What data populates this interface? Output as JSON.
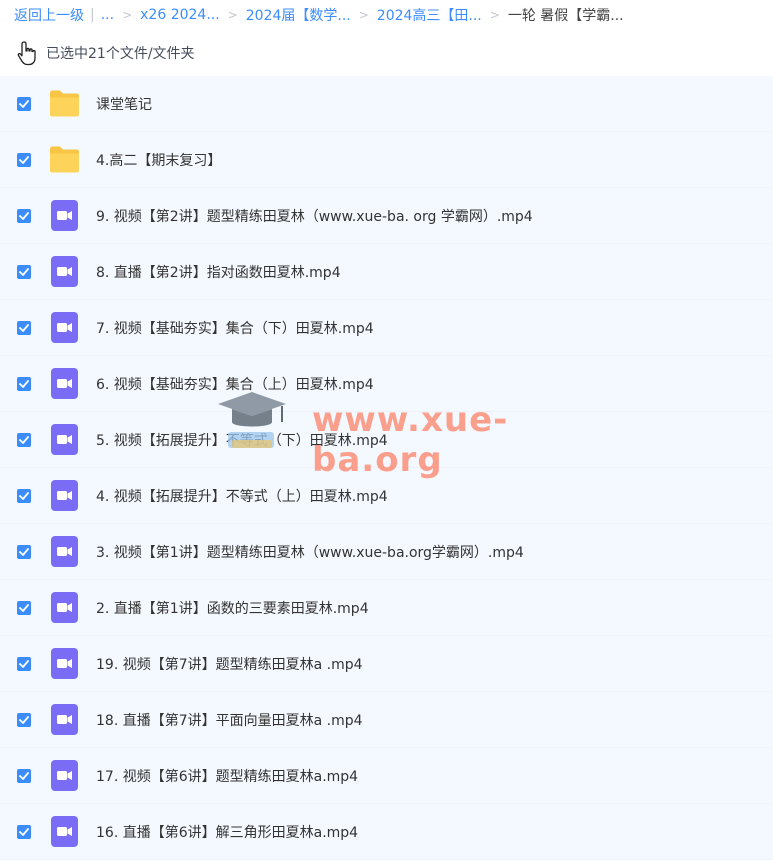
{
  "breadcrumb": {
    "back": "返回上一级",
    "ellipsis": "...",
    "items": [
      "x26 2024...",
      "2024届【数学...",
      "2024高三【田..."
    ],
    "current": "一轮 暑假【学霸..."
  },
  "selection": {
    "text": "已选中21个文件/文件夹"
  },
  "files": [
    {
      "type": "folder",
      "name": "课堂笔记",
      "checked": true
    },
    {
      "type": "folder",
      "name": "4.高二【期末复习】",
      "checked": true
    },
    {
      "type": "video",
      "name": "9. 视频【第2讲】题型精练田夏林（www.xue-ba. org 学霸网）.mp4",
      "checked": true
    },
    {
      "type": "video",
      "name": "8. 直播【第2讲】指对函数田夏林.mp4",
      "checked": true
    },
    {
      "type": "video",
      "name": "7. 视频【基础夯实】集合（下）田夏林.mp4",
      "checked": true
    },
    {
      "type": "video",
      "name": "6. 视频【基础夯实】集合（上）田夏林.mp4",
      "checked": true
    },
    {
      "type": "video",
      "name": "5. 视频【拓展提升】不等式（下）田夏林.mp4",
      "checked": true
    },
    {
      "type": "video",
      "name": "4. 视频【拓展提升】不等式（上）田夏林.mp4",
      "checked": true
    },
    {
      "type": "video",
      "name": "3. 视频【第1讲】题型精练田夏林（www.xue-ba.org学霸网）.mp4",
      "checked": true
    },
    {
      "type": "video",
      "name": "2. 直播【第1讲】函数的三要素田夏林.mp4",
      "checked": true
    },
    {
      "type": "video",
      "name": "19. 视频【第7讲】题型精练田夏林a .mp4",
      "checked": true
    },
    {
      "type": "video",
      "name": "18. 直播【第7讲】平面向量田夏林a .mp4",
      "checked": true
    },
    {
      "type": "video",
      "name": "17. 视频【第6讲】题型精练田夏林a.mp4",
      "checked": true
    },
    {
      "type": "video",
      "name": "16. 直播【第6讲】解三角形田夏林a.mp4",
      "checked": true
    }
  ],
  "watermark": {
    "text": "www.xue-ba.org"
  },
  "colors": {
    "accent": "#3b8cff",
    "folder": "#fdd35a",
    "video": "#7b6cf6",
    "row_bg": "#f4f8ff"
  }
}
